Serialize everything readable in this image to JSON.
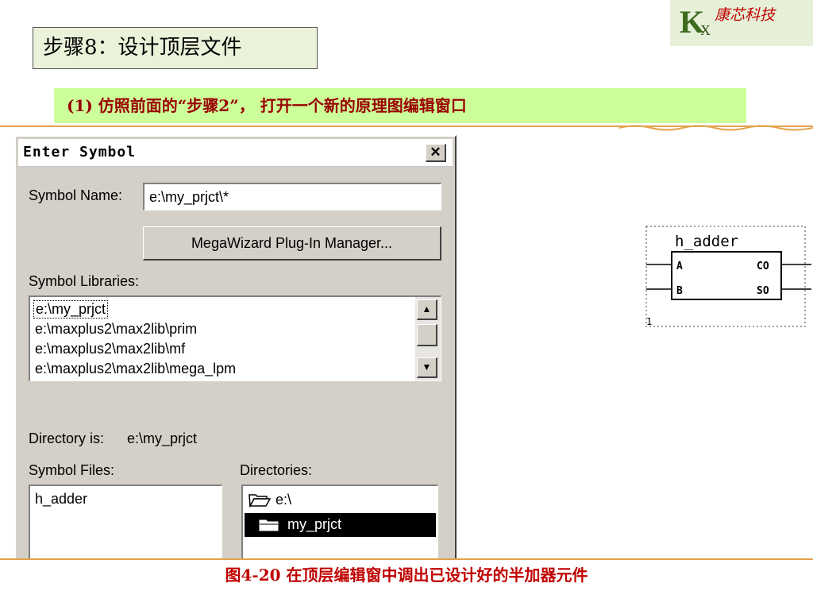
{
  "logo": {
    "k": "K",
    "x": "X",
    "company": "康芯科技"
  },
  "step_title": "步骤8：设计顶层文件",
  "subtitle": "(1) 仿照前面的“步骤2”， 打开一个新的原理图编辑窗口",
  "dialog": {
    "title": "Enter Symbol",
    "close_label": "✕",
    "symbol_name_label": "Symbol Name:",
    "symbol_name_value": "e:\\my_prjct\\*",
    "megawizard_label": "MegaWizard Plug-In Manager...",
    "libraries_label": "Symbol Libraries:",
    "libraries": [
      "e:\\my_prjct",
      "e:\\maxplus2\\max2lib\\prim",
      "e:\\maxplus2\\max2lib\\mf",
      "e:\\maxplus2\\max2lib\\mega_lpm"
    ],
    "directory_label": "Directory is:",
    "directory_value": "e:\\my_prjct",
    "symbol_files_label": "Symbol Files:",
    "symbol_files": [
      "h_adder"
    ],
    "directories_label": "Directories:",
    "directories": [
      "e:\\",
      "my_prjct"
    ]
  },
  "component": {
    "name": "h_adder",
    "inputs": [
      "A",
      "B"
    ],
    "outputs": [
      "CO",
      "SO"
    ],
    "index": "1"
  },
  "caption": "图4-20  在顶层编辑窗中调出已设计好的半加器元件",
  "colors": {
    "caption": "#c00000",
    "subtitle_bg": "#ccff99",
    "rule": "#e2a24a",
    "logo_green": "#3d6b1e"
  },
  "icons": [
    "close-icon",
    "scroll-up-icon",
    "scroll-down-icon",
    "folder-open-icon",
    "folder-icon"
  ]
}
